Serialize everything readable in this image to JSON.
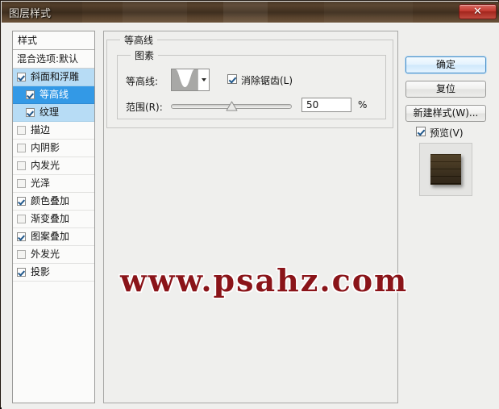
{
  "window": {
    "title": "图层样式",
    "close_label": "✕"
  },
  "styles_panel": {
    "header": "样式",
    "blend_options": "混合选项:默认",
    "effects": [
      {
        "label": "斜面和浮雕",
        "checked": true,
        "indent": false,
        "selection": "light"
      },
      {
        "label": "等高线",
        "checked": true,
        "indent": true,
        "selection": "dark"
      },
      {
        "label": "纹理",
        "checked": true,
        "indent": true,
        "selection": "light"
      },
      {
        "label": "描边",
        "checked": false,
        "indent": false,
        "selection": "none"
      },
      {
        "label": "内阴影",
        "checked": false,
        "indent": false,
        "selection": "none"
      },
      {
        "label": "内发光",
        "checked": false,
        "indent": false,
        "selection": "none"
      },
      {
        "label": "光泽",
        "checked": false,
        "indent": false,
        "selection": "none"
      },
      {
        "label": "颜色叠加",
        "checked": true,
        "indent": false,
        "selection": "none"
      },
      {
        "label": "渐变叠加",
        "checked": false,
        "indent": false,
        "selection": "none"
      },
      {
        "label": "图案叠加",
        "checked": true,
        "indent": false,
        "selection": "none"
      },
      {
        "label": "外发光",
        "checked": false,
        "indent": false,
        "selection": "none"
      },
      {
        "label": "投影",
        "checked": true,
        "indent": false,
        "selection": "none"
      }
    ]
  },
  "main_panel": {
    "group_title": "等高线",
    "subgroup_title": "图素",
    "contour_label": "等高线:",
    "contour_icon": "contour-curve-cone-inverted",
    "antialias_label": "消除锯齿(L)",
    "antialias_checked": true,
    "range_label": "范围(R):",
    "range_value": "50",
    "range_unit": "%",
    "range_percent": 50,
    "watermark": "www.psahz.com"
  },
  "buttons": {
    "ok": "确定",
    "reset": "复位",
    "new_style": "新建样式(W)...",
    "preview_label": "预览(V)",
    "preview_checked": true
  },
  "colors": {
    "accent_selected": "#3399e6",
    "accent_selected_soft": "#b7dcf5",
    "titlebar_brown": "#3f2f1f",
    "close_red": "#c33a30",
    "watermark_red": "#8a1419",
    "dialog_bg": "#efefed",
    "swatch_brown": "#3a2c16"
  }
}
